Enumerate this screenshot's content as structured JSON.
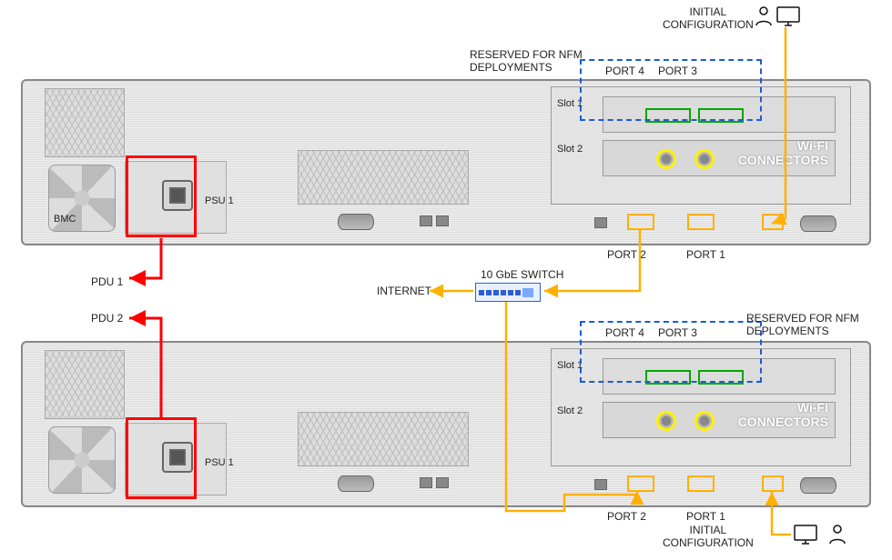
{
  "top_labels": {
    "initial_config": "INITIAL\nCONFIGURATION",
    "reserved_nfm": "RESERVED FOR NFM\nDEPLOYMENTS"
  },
  "bottom_labels": {
    "initial_config": "INITIAL\nCONFIGURATION",
    "reserved_nfm": "RESERVED FOR NFM\nDEPLOYMENTS"
  },
  "server1": {
    "bmc": "BMC",
    "psu_label": "PSU 1",
    "slot1": "Slot 1",
    "slot2": "Slot 2",
    "wifi_label": "Wi-FI\nCONNECTORS",
    "port1": "PORT 1",
    "port2": "PORT 2",
    "port3": "PORT 3",
    "port4": "PORT 4"
  },
  "server2": {
    "psu_label": "PSU 1",
    "slot1": "Slot 1",
    "slot2": "Slot 2",
    "wifi_label": "Wi-FI\nCONNECTORS",
    "port1": "PORT 1",
    "port2": "PORT 2",
    "port3": "PORT 3",
    "port4": "PORT 4"
  },
  "pdu1": "PDU 1",
  "pdu2": "PDU 2",
  "switch_label": "10 GbE SWITCH",
  "internet": "INTERNET",
  "colors": {
    "red": "#ff0000",
    "orange": "#ffb000",
    "green": "#00a800",
    "blue": "#1a5bd8",
    "yellow": "#fff200"
  }
}
